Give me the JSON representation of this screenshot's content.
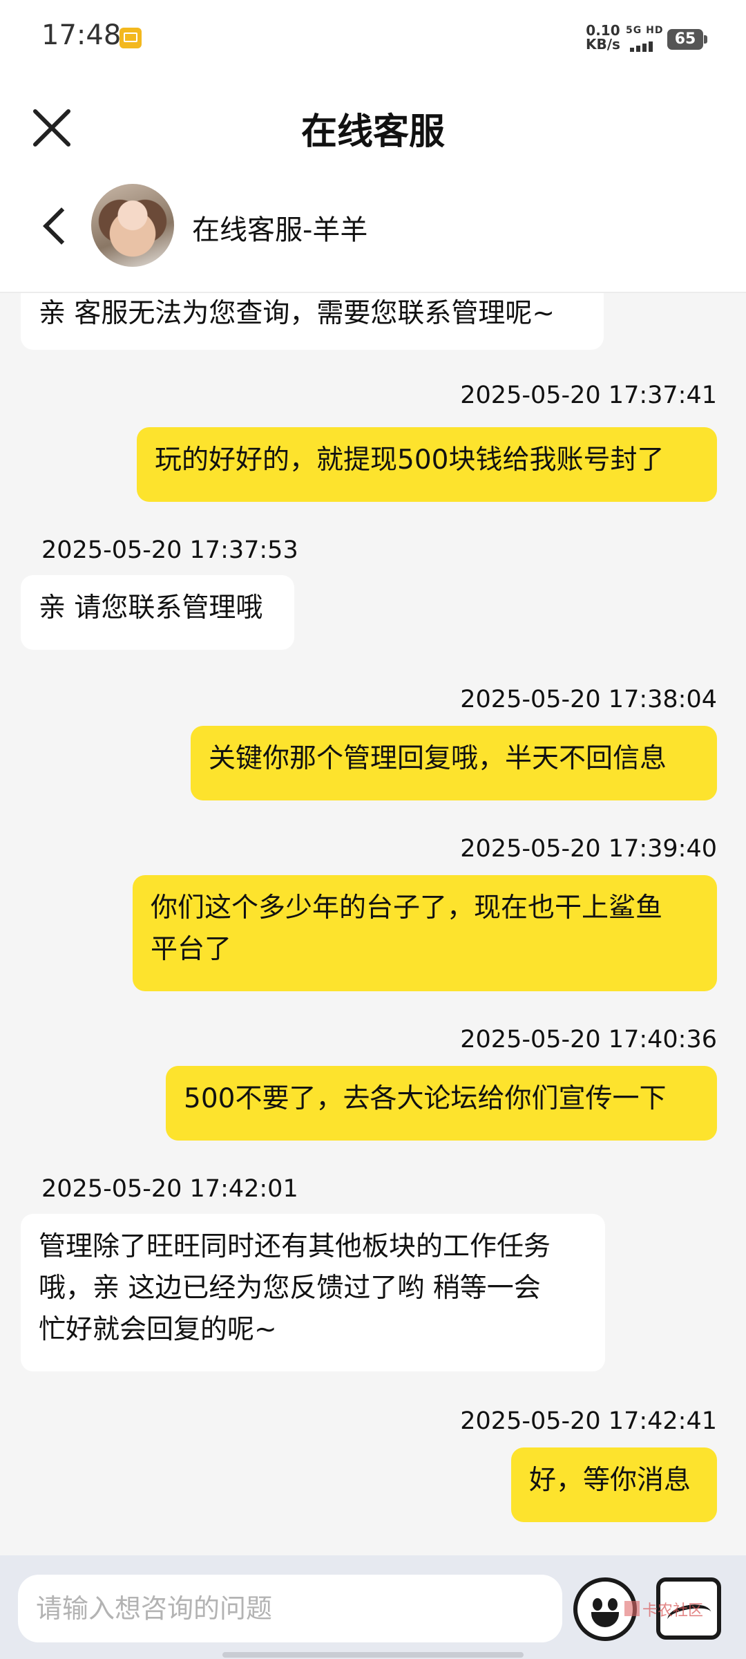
{
  "status_bar": {
    "time": "17:48",
    "speed_value": "0.10",
    "speed_unit": "KB/s",
    "network": "5G HD",
    "battery": "65"
  },
  "header": {
    "title": "在线客服",
    "agent_name": "在线客服-羊羊"
  },
  "messages": [
    {
      "side": "left",
      "text": "亲 客服无法为您查询，需要您联系管理呢~"
    },
    {
      "timestamp": "2025-05-20 17:37:41"
    },
    {
      "side": "right",
      "text": "玩的好好的，就提现500块钱给我账号封了"
    },
    {
      "timestamp": "2025-05-20 17:37:53"
    },
    {
      "side": "left",
      "text": "亲 请您联系管理哦"
    },
    {
      "timestamp": "2025-05-20 17:38:04"
    },
    {
      "side": "right",
      "text": "关键你那个管理回复哦，半天不回信息"
    },
    {
      "timestamp": "2025-05-20 17:39:40"
    },
    {
      "side": "right",
      "text_line1": "你们这个多少年的台子了，现在也干上鲨鱼",
      "text_line2": "平台了"
    },
    {
      "timestamp": "2025-05-20 17:40:36"
    },
    {
      "side": "right",
      "text": "500不要了，去各大论坛给你们宣传一下"
    },
    {
      "timestamp": "2025-05-20 17:42:01"
    },
    {
      "side": "left",
      "text_line1": "管理除了旺旺同时还有其他板块的工作任务",
      "text_line2": "哦，亲 这边已经为您反馈过了哟 稍等一会",
      "text_line3": "忙好就会回复的呢~"
    },
    {
      "timestamp": "2025-05-20 17:42:41"
    },
    {
      "side": "right",
      "text": "好，等你消息"
    }
  ],
  "input": {
    "placeholder": "请输入想咨询的问题"
  },
  "watermark": "卡农社区",
  "icons": {
    "close": "close-icon",
    "back": "chevron-left-icon",
    "emoji": "smiley-icon",
    "image": "image-icon"
  },
  "colors": {
    "outgoing_bubble": "#fde32d",
    "incoming_bubble": "#ffffff",
    "chat_background": "#f5f5f5",
    "input_bar": "#e6e9f0"
  }
}
